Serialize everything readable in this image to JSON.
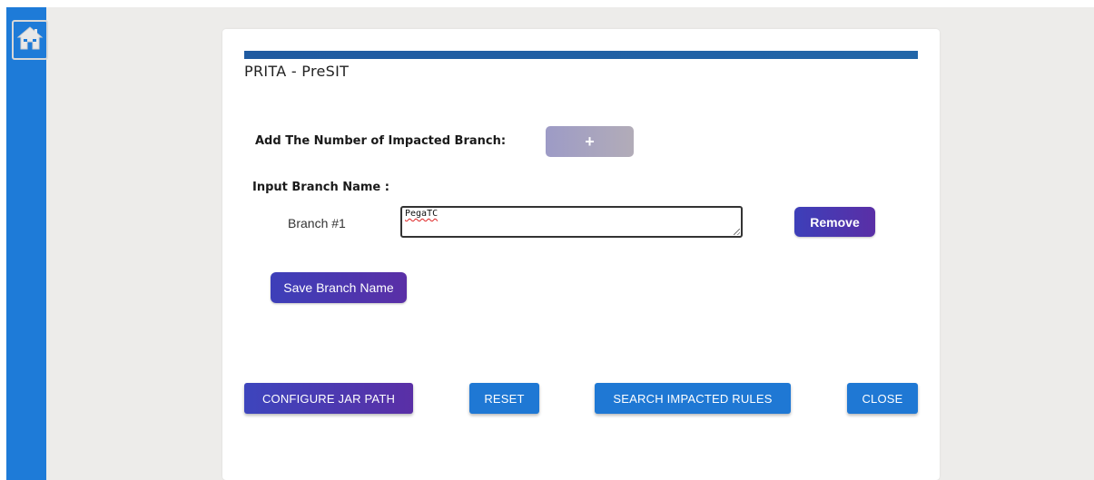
{
  "page": {
    "title": "PRITA - PreSIT"
  },
  "sidebar": {
    "home_icon": "home-icon"
  },
  "branch_form": {
    "add_label": "Add The Number of Impacted Branch:",
    "add_button": "+",
    "input_section_label": "Input Branch Name :",
    "branches": [
      {
        "label": "Branch #1",
        "value": "PegaTC",
        "remove_label": "Remove"
      }
    ],
    "save_button": "Save Branch Name"
  },
  "actions": {
    "configure": "CONFIGURE JAR PATH",
    "reset": "RESET",
    "search": "SEARCH IMPACTED RULES",
    "close": "CLOSE"
  },
  "colors": {
    "sidebar": "#1e7bd8",
    "title_bar": "#1f5aa0",
    "primary_blue": "#1f78d4",
    "gradient_purple_start": "#3d3fb9",
    "gradient_purple_end": "#5a2fa6",
    "add_button_bg": "#a8a4c0",
    "background": "#edecea"
  }
}
